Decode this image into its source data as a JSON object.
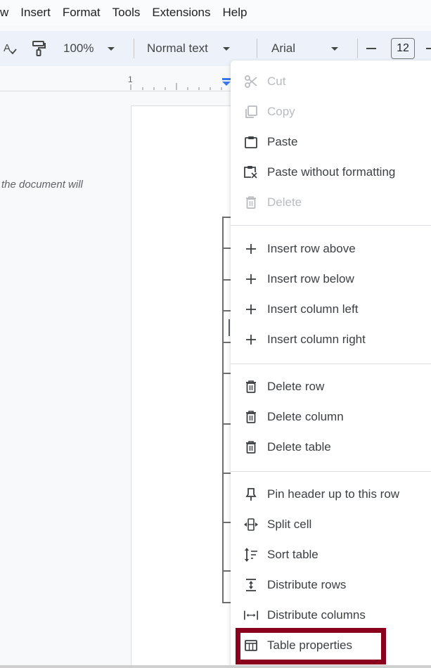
{
  "menubar": {
    "items": [
      "w",
      "Insert",
      "Format",
      "Tools",
      "Extensions",
      "Help"
    ]
  },
  "toolbar": {
    "zoom": "100%",
    "style": "Normal text",
    "font": "Arial",
    "font_size": "12",
    "decrease_label": "–"
  },
  "ruler": {
    "marker": "1"
  },
  "document": {
    "outline_text": "the document will"
  },
  "context_menu": {
    "items": [
      {
        "label": "Cut",
        "icon": "scissors-icon",
        "disabled": true
      },
      {
        "label": "Copy",
        "icon": "copy-icon",
        "disabled": true
      },
      {
        "label": "Paste",
        "icon": "clipboard-icon",
        "disabled": false
      },
      {
        "label": "Paste without formatting",
        "icon": "paste-plain-icon",
        "disabled": false
      },
      {
        "label": "Delete",
        "icon": "trash-icon",
        "disabled": true
      },
      {
        "label": "Insert row above",
        "icon": "plus-icon",
        "disabled": false
      },
      {
        "label": "Insert row below",
        "icon": "plus-icon",
        "disabled": false
      },
      {
        "label": "Insert column left",
        "icon": "plus-icon",
        "disabled": false
      },
      {
        "label": "Insert column right",
        "icon": "plus-icon",
        "disabled": false
      },
      {
        "label": "Delete row",
        "icon": "trash-icon",
        "disabled": false
      },
      {
        "label": "Delete column",
        "icon": "trash-icon",
        "disabled": false
      },
      {
        "label": "Delete table",
        "icon": "trash-icon",
        "disabled": false
      },
      {
        "label": "Pin header up to this row",
        "icon": "pin-icon",
        "disabled": false
      },
      {
        "label": "Split cell",
        "icon": "split-cell-icon",
        "disabled": false
      },
      {
        "label": "Sort table",
        "icon": "sort-icon",
        "disabled": false
      },
      {
        "label": "Distribute rows",
        "icon": "distribute-rows-icon",
        "disabled": false
      },
      {
        "label": "Distribute columns",
        "icon": "distribute-columns-icon",
        "disabled": false
      },
      {
        "label": "Table properties",
        "icon": "table-icon",
        "disabled": false,
        "highlighted": true
      }
    ]
  },
  "colors": {
    "highlight_border": "#8b001c",
    "ruler_marker": "#3b78e7",
    "disabled_text": "#b8bbbf"
  }
}
